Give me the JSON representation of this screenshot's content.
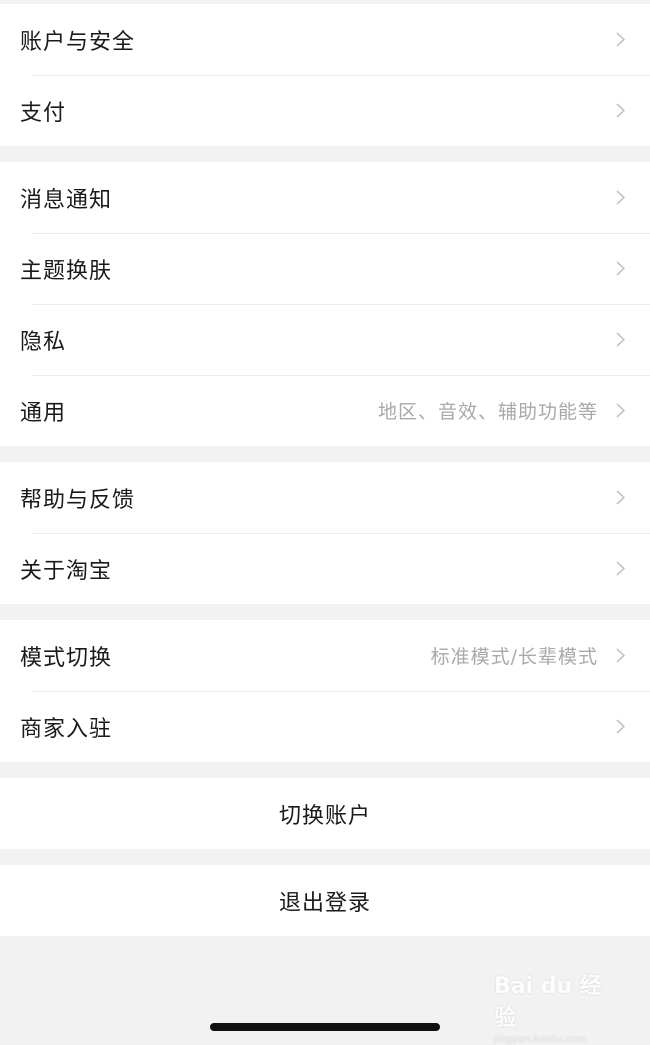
{
  "groups": [
    {
      "items": [
        {
          "label": "账户与安全",
          "detail": ""
        },
        {
          "label": "支付",
          "detail": ""
        }
      ]
    },
    {
      "items": [
        {
          "label": "消息通知",
          "detail": ""
        },
        {
          "label": "主题换肤",
          "detail": ""
        },
        {
          "label": "隐私",
          "detail": ""
        },
        {
          "label": "通用",
          "detail": "地区、音效、辅助功能等"
        }
      ]
    },
    {
      "items": [
        {
          "label": "帮助与反馈",
          "detail": ""
        },
        {
          "label": "关于淘宝",
          "detail": ""
        }
      ]
    },
    {
      "items": [
        {
          "label": "模式切换",
          "detail": "标准模式/长辈模式"
        },
        {
          "label": "商家入驻",
          "detail": ""
        }
      ]
    }
  ],
  "actions": {
    "switch_account": "切换账户",
    "logout": "退出登录"
  },
  "watermark": {
    "logo": "Bai du 经验",
    "sub": "jingyan.baidu.com"
  },
  "colors": {
    "background": "#f2f2f2",
    "text": "#1a1a1a",
    "detail_text": "#a9a9a9",
    "chevron": "#c4c4c4"
  }
}
